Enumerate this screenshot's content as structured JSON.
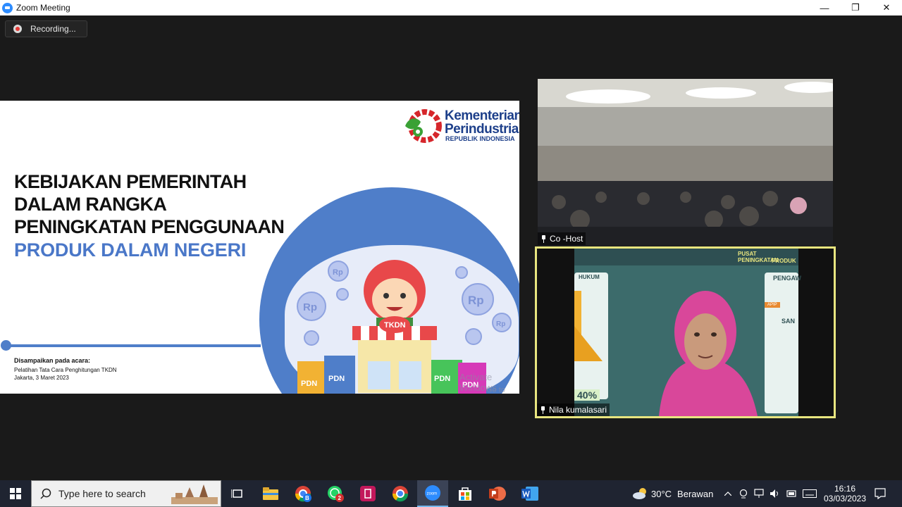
{
  "window": {
    "title": "Zoom Meeting",
    "controls": {
      "minimize": "—",
      "restore": "❐",
      "close": "✕"
    }
  },
  "recording": {
    "label": "Recording..."
  },
  "slide": {
    "logo": {
      "line1": "Kementerian",
      "line2": "Perindustrian",
      "line3": "REPUBLIK INDONESIA"
    },
    "title_lines": [
      "KEBIJAKAN PEMERINTAH",
      "DALAM RANGKA",
      "PENINGKATAN PENGGUNAAN"
    ],
    "subtitle": "PRODUK DALAM NEGERI",
    "event": {
      "heading": "Disampaikan pada acara:",
      "line1": "Pelatihan Tata Cara Penghitungan TKDN",
      "line2": "Jakarta, 3 Maret 2023"
    },
    "shop_sign": "TKDN",
    "coin_label": "Rp",
    "bag_label": "PDN",
    "watermark": [
      "Activate Windows",
      "Go to Settings to activate Windows."
    ]
  },
  "participants": [
    {
      "name": "Co -Host"
    },
    {
      "name": "Nila kumalasari"
    }
  ],
  "shared_screen": {
    "header": "PUSAT PENINGKATAN",
    "header2": "PRODUK",
    "left_label": "HUKUM",
    "right_label": "PENGAW",
    "right_label2": "SAN",
    "percent": "40%",
    "button": "APIP"
  },
  "taskbar": {
    "search_placeholder": "Type here to search",
    "weather": {
      "temp": "30°C",
      "condition": "Berawan"
    },
    "clock": {
      "time": "16:16",
      "date": "03/03/2023"
    },
    "badges": {
      "chrome_profile": "B",
      "whatsapp": "2"
    },
    "zoom_icon_label": "zoom"
  }
}
